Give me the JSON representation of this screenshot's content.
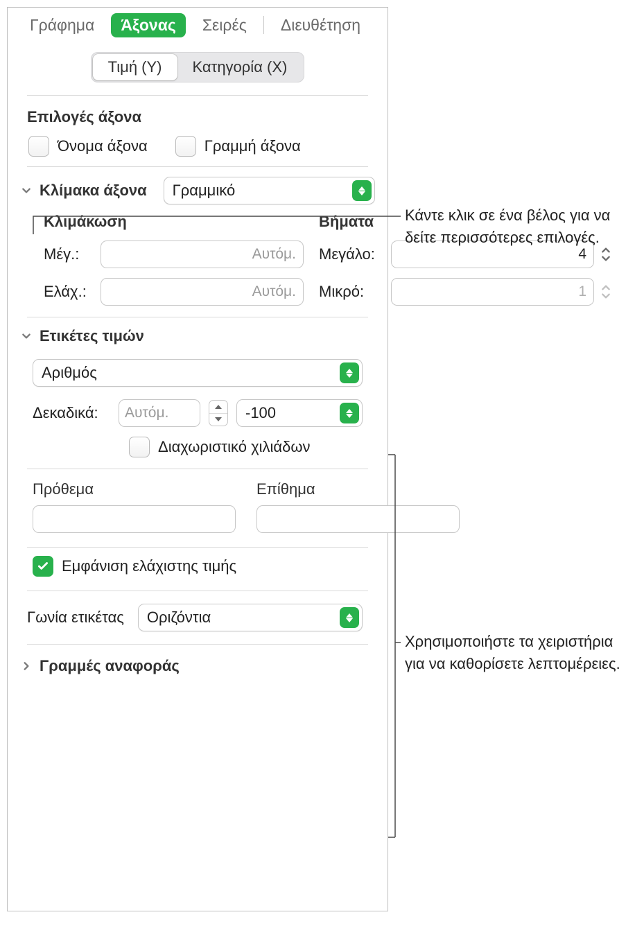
{
  "tabs": {
    "chart": "Γράφημα",
    "axis": "Άξονας",
    "series": "Σειρές",
    "arrange": "Διευθέτηση"
  },
  "segmented": {
    "y": "Τιμή (Y)",
    "x": "Κατηγορία (X)"
  },
  "axis_options": {
    "title": "Επιλογές άξονα",
    "axis_name": "Όνομα άξονα",
    "axis_line": "Γραμμή άξονα"
  },
  "axis_scale": {
    "title": "Κλίμακα άξονα",
    "type": "Γραμμικό",
    "scaling_header": "Κλιμάκωση",
    "steps_header": "Βήματα",
    "max_label": "Μέγ.:",
    "max_placeholder": "Αυτόμ.",
    "min_label": "Ελάχ.:",
    "min_placeholder": "Αυτόμ.",
    "major_label": "Μεγάλο:",
    "major_value": "4",
    "minor_label": "Μικρό:",
    "minor_value": "1"
  },
  "value_labels": {
    "title": "Ετικέτες τιμών",
    "format": "Αριθμός",
    "decimals_label": "Δεκαδικά:",
    "decimals_placeholder": "Αυτόμ.",
    "negative_format": "-100",
    "thousands_sep": "Διαχωριστικό χιλιάδων",
    "prefix": "Πρόθεμα",
    "suffix": "Επίθημα",
    "show_min": "Εμφάνιση ελάχιστης τιμής"
  },
  "label_angle": {
    "label": "Γωνία ετικέτας",
    "value": "Οριζόντια"
  },
  "reference_lines": "Γραμμές αναφοράς",
  "callouts": {
    "c1": "Κάντε κλικ σε ένα βέλος για να δείτε περισσότερες επιλογές.",
    "c2": "Χρησιμοποιήστε τα χειριστήρια για να καθορίσετε λεπτομέρειες."
  }
}
